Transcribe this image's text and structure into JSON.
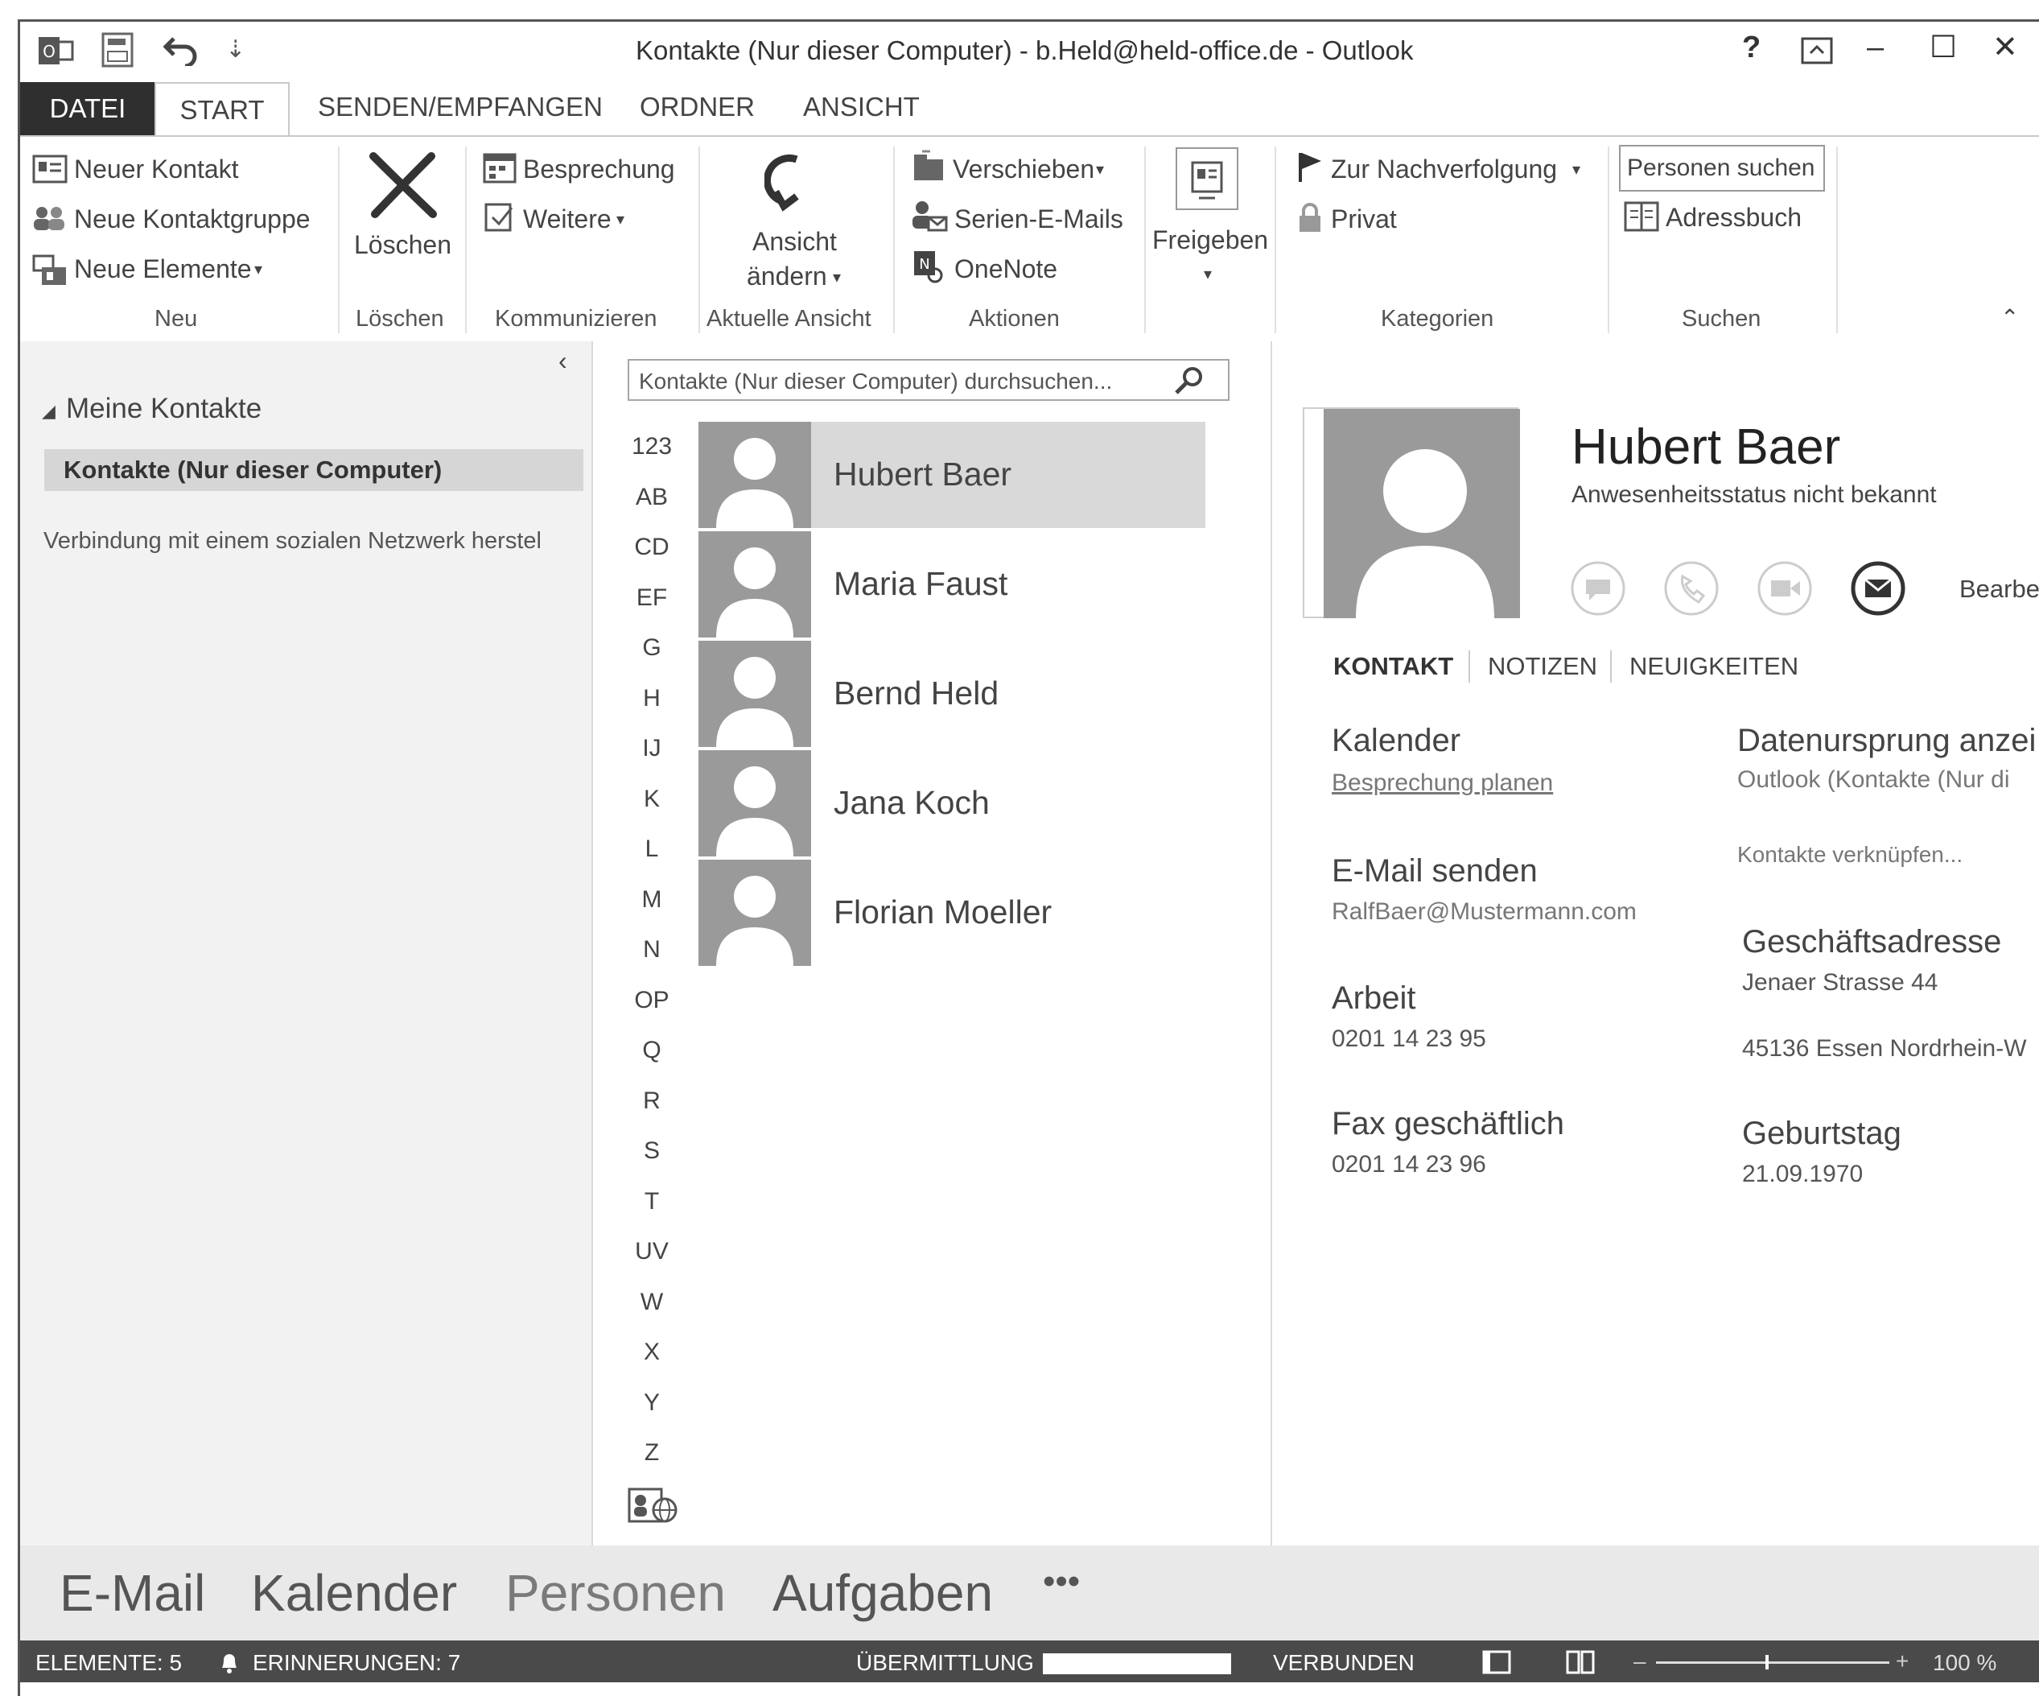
{
  "titlebar": {
    "title": "Kontakte (Nur dieser Computer) - b.Held@held-office.de - Outlook",
    "help": "?",
    "minimize": "–",
    "maximize": "☐",
    "close": "✕"
  },
  "tabs": [
    "DATEI",
    "START",
    "SENDEN/EMPFANGEN",
    "ORDNER",
    "ANSICHT"
  ],
  "ribbon": {
    "neu": {
      "neuer_kontakt": "Neuer Kontakt",
      "neue_kontaktgruppe": "Neue Kontaktgruppe",
      "neue_elemente": "Neue Elemente",
      "group": "Neu"
    },
    "loeschen": {
      "button": "Löschen",
      "group": "Löschen"
    },
    "kommunizieren": {
      "besprechung": "Besprechung",
      "weitere": "Weitere",
      "group": "Kommunizieren"
    },
    "aktuelle_ansicht": {
      "line1": "Ansicht",
      "line2": "ändern",
      "group": "Aktuelle Ansicht"
    },
    "aktionen": {
      "verschieben": "Verschieben",
      "serien": "Serien-E-Mails",
      "onenote": "OneNote",
      "group": "Aktionen"
    },
    "freigeben": {
      "label": "Freigeben"
    },
    "kategorien": {
      "nachverfolgung": "Zur Nachverfolgung",
      "privat": "Privat",
      "group": "Kategorien"
    },
    "suchen": {
      "personen": "Personen suchen",
      "adressbuch": "Adressbuch",
      "group": "Suchen"
    }
  },
  "folders": {
    "header": "Meine Kontakte",
    "selected": "Kontakte (Nur dieser Computer)",
    "social": "Verbindung mit einem sozialen Netzwerk herstel"
  },
  "search": {
    "placeholder": "Kontakte (Nur dieser Computer) durchsuchen..."
  },
  "alphabet": [
    "123",
    "AB",
    "CD",
    "EF",
    "G",
    "H",
    "IJ",
    "K",
    "L",
    "M",
    "N",
    "OP",
    "Q",
    "R",
    "S",
    "T",
    "UV",
    "W",
    "X",
    "Y",
    "Z"
  ],
  "contacts": [
    "Hubert Baer",
    "Maria Faust",
    "Bernd Held",
    "Jana Koch",
    "Florian Moeller"
  ],
  "detail": {
    "name": "Hubert Baer",
    "status": "Anwesenheitsstatus nicht bekannt",
    "edit": "Bearbe",
    "tabs": [
      "KONTAKT",
      "NOTIZEN",
      "NEUIGKEITEN"
    ],
    "kalender_label": "Kalender",
    "kalender_link": "Besprechung planen",
    "email_label": "E-Mail senden",
    "email_value": "RalfBaer@Mustermann.com",
    "arbeit_label": "Arbeit",
    "arbeit_value": "0201 14 23 95",
    "fax_label": "Fax geschäftlich",
    "fax_value": "0201 14 23 96",
    "datenursprung_label": "Datenursprung anzei",
    "datenursprung_value": "Outlook (Kontakte (Nur di",
    "verknuepfen": "Kontakte verknüpfen...",
    "adresse_label": "Geschäftsadresse",
    "adresse_line1": "Jenaer Strasse 44",
    "adresse_line2": "45136  Essen  Nordrhein-W",
    "geburtstag_label": "Geburtstag",
    "geburtstag_value": "21.09.1970"
  },
  "nav": [
    "E-Mail",
    "Kalender",
    "Personen",
    "Aufgaben",
    "•••"
  ],
  "status": {
    "elemente": "ELEMENTE: 5",
    "erinnerungen": "ERINNERUNGEN: 7",
    "uebermittlung": "ÜBERMITTLUNG",
    "verbunden": "VERBUNDEN",
    "zoom": "100 %"
  }
}
